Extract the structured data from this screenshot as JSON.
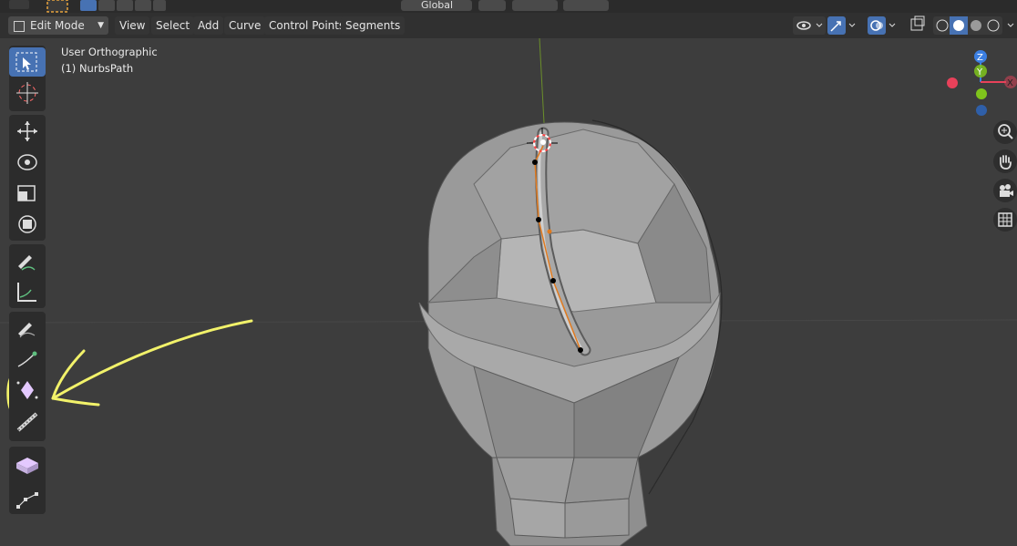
{
  "header": {
    "mode_label": "Edit Mode",
    "menus": [
      "View",
      "Select",
      "Add",
      "Curve",
      "Control Points",
      "Segments"
    ],
    "transform_orientation": "Global"
  },
  "viewport": {
    "view_name": "User Orthographic",
    "object_name": "(1) NurbsPath"
  },
  "gizmo": {
    "z_label": "Z",
    "y_label": "Y",
    "x_label": "X"
  },
  "colors": {
    "accent": "#4772b3",
    "annotation": "#f2f26a",
    "curve": "#e07a1f",
    "x_axis": "#e8415a",
    "y_axis": "#7fc41c",
    "z_axis": "#3b7fe3"
  },
  "toolbar": {
    "tools": [
      "select-box-icon",
      "cursor-icon",
      "move-icon",
      "rotate-icon",
      "scale-icon",
      "transform-icon",
      "annotate-icon",
      "measure-icon",
      "draw-icon",
      "extrude-icon",
      "radius-icon",
      "tilt-icon",
      "randomize-icon",
      "curve-pen-icon"
    ]
  }
}
